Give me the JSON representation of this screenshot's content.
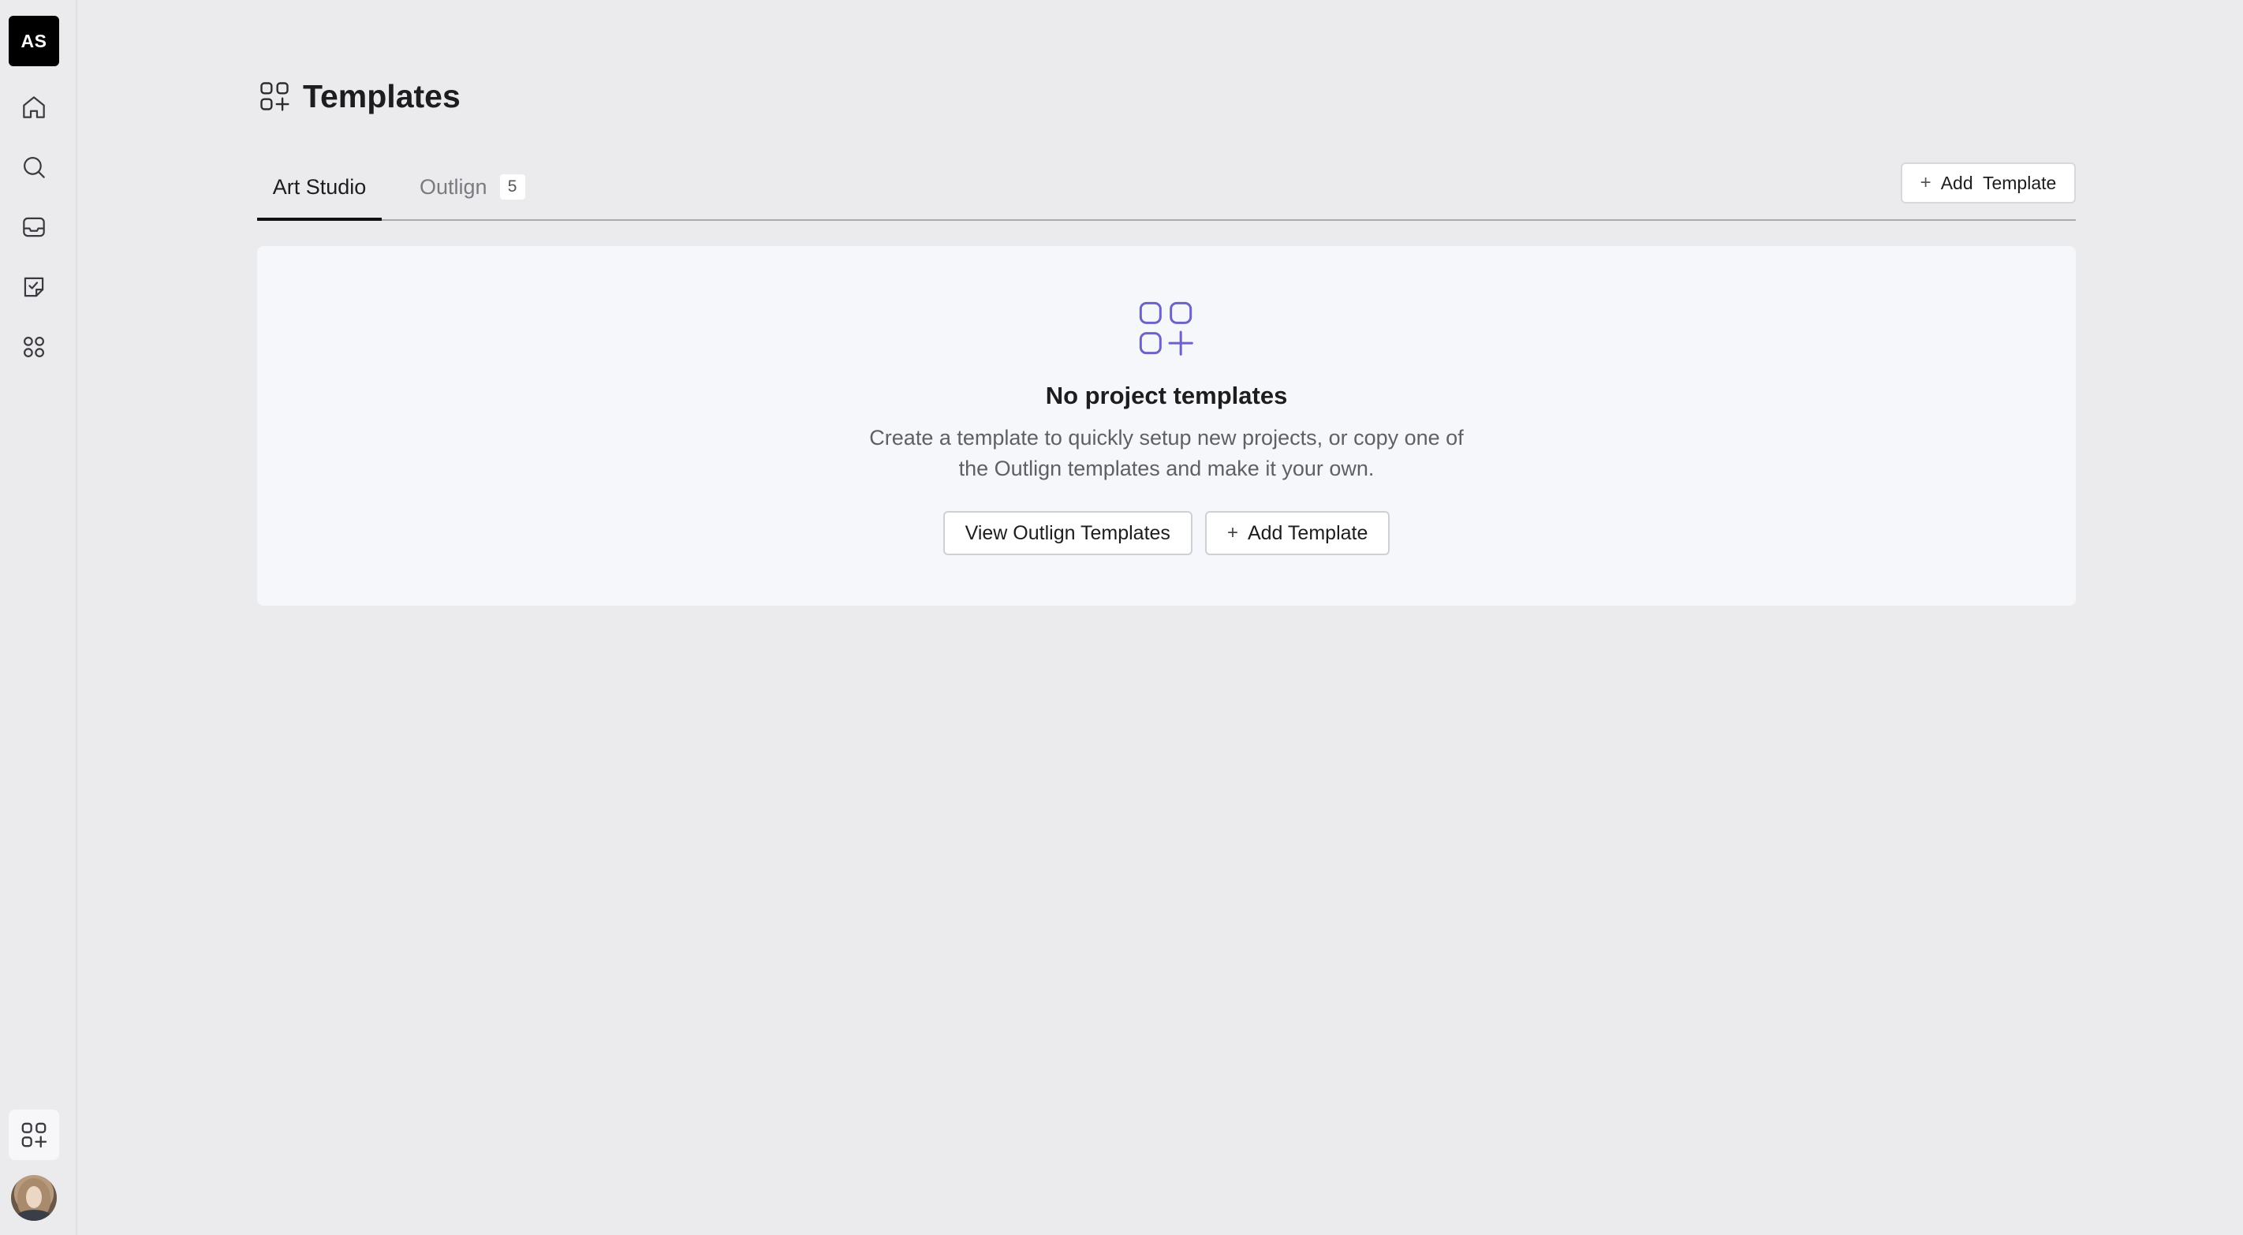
{
  "sidebar": {
    "workspace_initials": "AS",
    "nav": [
      {
        "icon": "home-icon"
      },
      {
        "icon": "search-icon"
      },
      {
        "icon": "inbox-icon"
      },
      {
        "icon": "tasks-icon"
      },
      {
        "icon": "apps-icon"
      }
    ],
    "bottom_button_icon": "templates-icon",
    "avatar": "user-avatar"
  },
  "header": {
    "icon": "templates-icon",
    "title": "Templates"
  },
  "tabs": [
    {
      "label": "Art Studio",
      "active": true
    },
    {
      "label": "Outlign",
      "count": "5",
      "active": false
    }
  ],
  "toolbar": {
    "add_template_label": "Add  Template"
  },
  "empty_state": {
    "icon": "templates-icon",
    "title": "No project templates",
    "description": "Create a template to quickly setup new projects, or copy one of the Outlign templates and make it your own.",
    "view_button_label": "View Outlign Templates",
    "add_button_label": "Add Template"
  },
  "colors": {
    "background": "#ebebee",
    "card": "#f6f7fa",
    "accent_icon": "#6b63c9",
    "badge": "#000000"
  }
}
